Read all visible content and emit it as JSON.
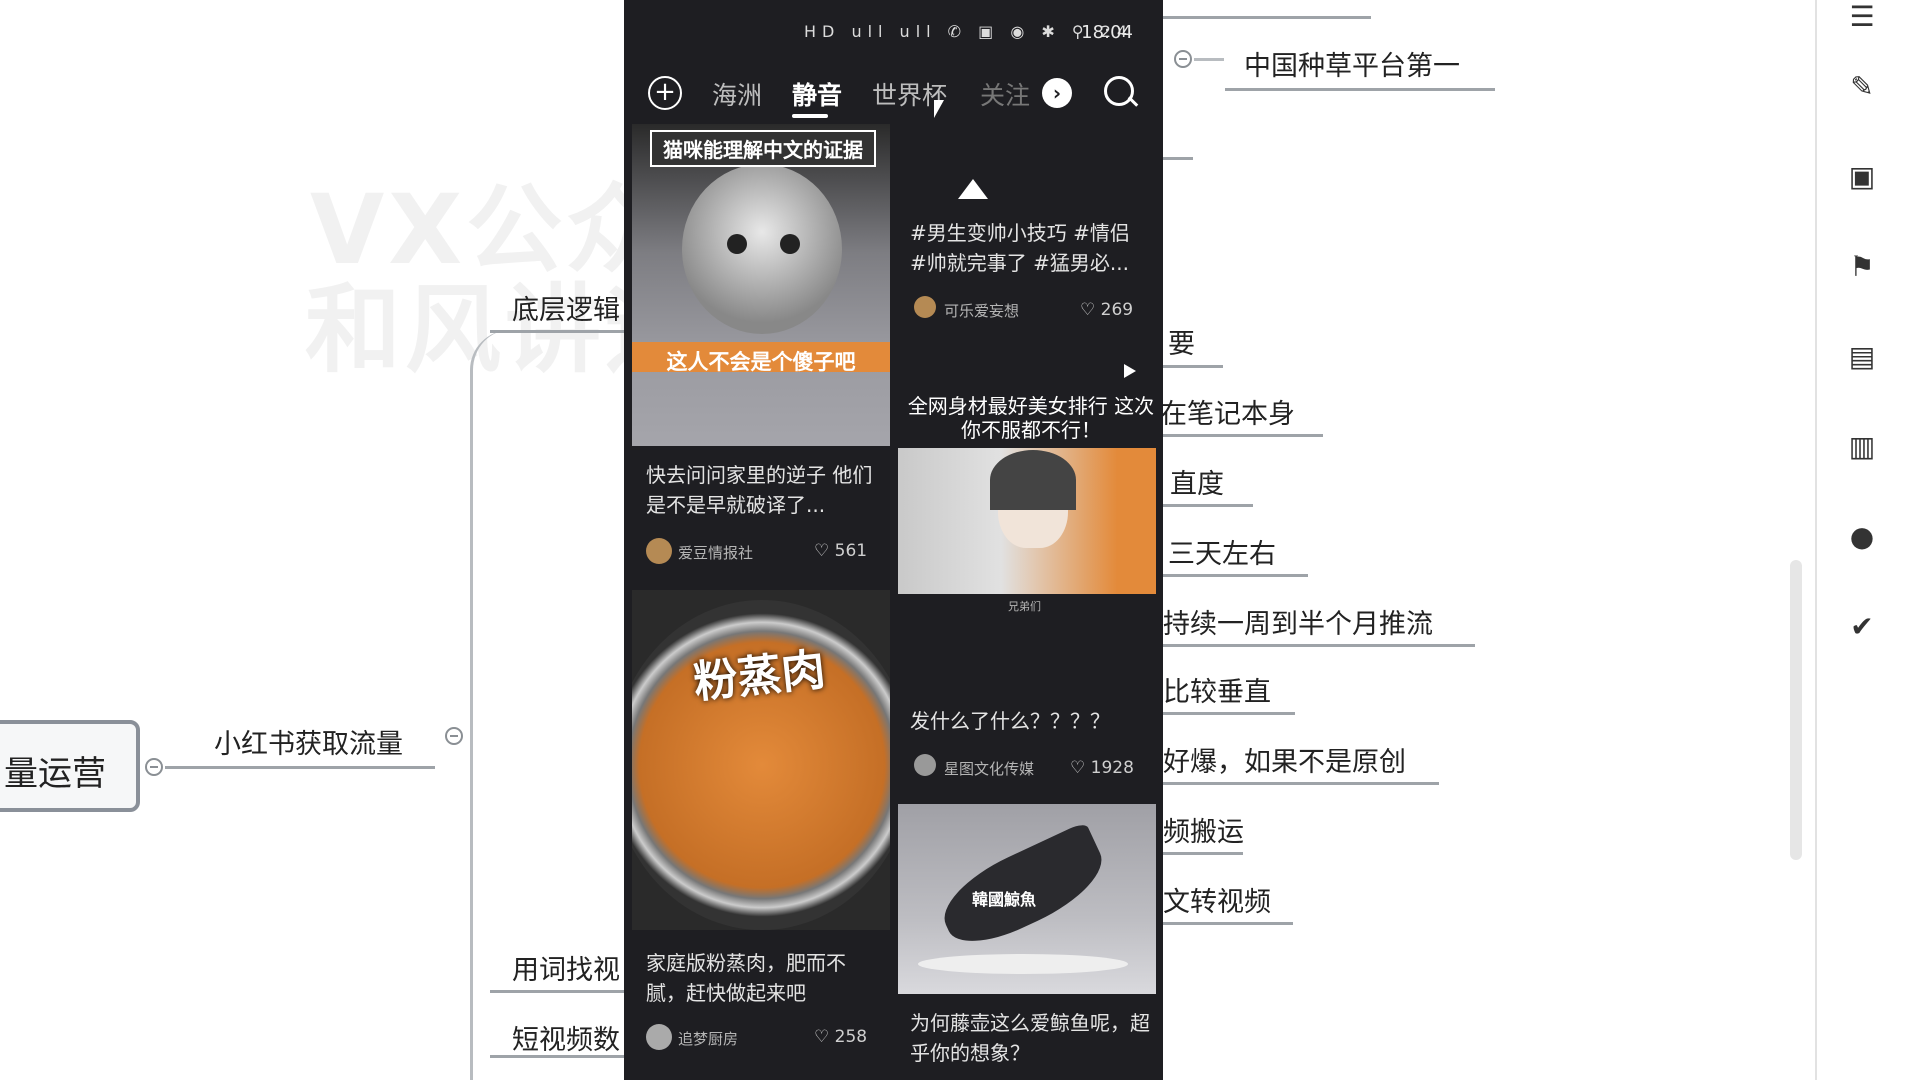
{
  "mindmap": {
    "root_label": "量运营",
    "branch_label": "小红书获取流量",
    "sub_branches": [
      "底层逻辑",
      "用词找视",
      "短视频数"
    ],
    "right_items": [
      "中国种草平台第一",
      "要",
      "在笔记本身",
      "直度",
      "三天左右",
      "持续一周到半个月推流",
      "比较垂直",
      "好爆，如果不是原创",
      "频搬运",
      "文转视频"
    ],
    "watermark_lines": [
      "VX公众号",
      "和风讲运营"
    ]
  },
  "phone": {
    "status_time": "18:04",
    "status_icons": "HD ull ull ✆ ▣ ◉ ✱ ⚲ 24",
    "tabs": [
      "海洲",
      "静音",
      "世界杯",
      "关注"
    ],
    "active_tab": "静音",
    "left_column": [
      {
        "overlay_top": "猫咪能理解中文的证据",
        "overlay_bottom": "这人不会是个傻子吧",
        "title": "快去问问家里的逆子 他们是不是早就破译了...",
        "author": "爱豆情报社",
        "likes": "561"
      },
      {
        "overlay_top": "粉蒸肉",
        "title": "家庭版粉蒸肉，肥而不腻，赶快做起来吧",
        "author": "追梦厨房",
        "likes": "258"
      }
    ],
    "right_column": [
      {
        "title": "#男生变帅小技巧 #情侣 #帅就完事了 #猛男必...",
        "author": "可乐爱妄想",
        "likes": "269"
      },
      {
        "overlay_top": "全网身材最好美女排行 这次 你不服都不行！",
        "caption": "兄弟们",
        "title": "发什么了什么？？？？",
        "author": "星图文化传媒",
        "likes": "1928"
      },
      {
        "overlay_top": "韓國鯨魚",
        "title": "为何藤壶这么爱鲸鱼呢，超乎你的想象？",
        "author": "",
        "likes": ""
      }
    ]
  },
  "colors": {
    "phone_bg": "#1e1e22",
    "accent_orange": "#e38a3a",
    "mindmap_line": "#9ea3a8"
  }
}
